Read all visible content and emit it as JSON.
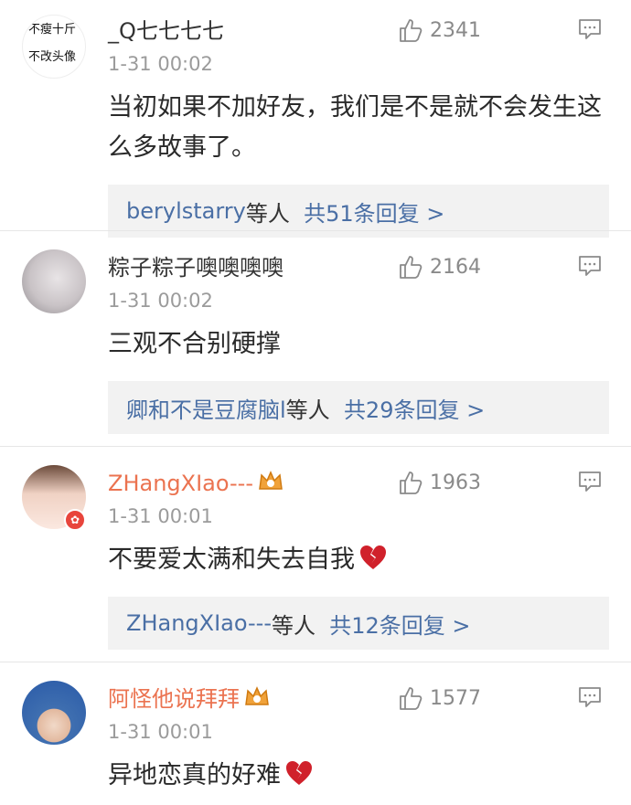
{
  "comments": [
    {
      "username": "_Q七七七七",
      "username_color": "#333333",
      "avatar_text": [
        "不瘦十斤",
        "不改头像"
      ],
      "timestamp": "1-31 00:02",
      "likes": "2341",
      "text": "当初如果不加好友，我们是不是就不会发生这么多故事了。",
      "replies": {
        "user": "berylstarry",
        "suffix": "等人",
        "count_text": "共51条回复 >"
      }
    },
    {
      "username": "粽子粽子噢噢噢噢",
      "username_color": "#333333",
      "timestamp": "1-31 00:02",
      "likes": "2164",
      "text": "三观不合别硬撑",
      "replies": {
        "user": "卿和不是豆腐脑l",
        "suffix": "等人",
        "count_text": "共29条回复 >"
      }
    },
    {
      "username": "ZHangXIao---",
      "username_color": "#eb7350",
      "timestamp": "1-31 00:01",
      "likes": "1963",
      "text": "不要爱太满和失去自我",
      "replies": {
        "user": "ZHangXIao---",
        "suffix": "等人",
        "count_text": "共12条回复 >"
      }
    },
    {
      "username": "阿怪他说拜拜",
      "username_color": "#eb7350",
      "timestamp": "1-31 00:01",
      "likes": "1577",
      "text": "异地恋真的好难"
    }
  ]
}
